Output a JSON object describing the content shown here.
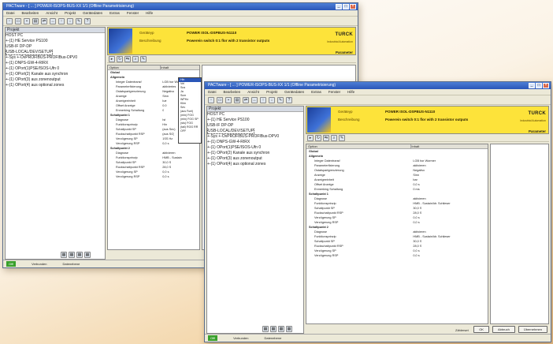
{
  "window1": {
    "title": "PACTware - [ ... ] POWER-ISOPS-BUS-XX 1/1 (Offline Parametrisierung)",
    "menu": [
      "Datei",
      "Bearbeiten",
      "Ansicht",
      "Projekt",
      "Gerätedaten",
      "Extras",
      "Fenster",
      "Hilfe"
    ],
    "tree_header": "Projekt",
    "tree": [
      "HOST PC",
      "+-(1) HE Service PS100",
      "   USB-IF DP-DP",
      "      USB-LOCAL/DEV/SETUP",
      "+-Sys  +-OvPROFIBUS-PROFIBus-DPV0",
      "      +-(1) DNPS-GW-4-RIRX",
      "         +-(1) OPort(1)PSE/ISOS-Ufn 0",
      "         +-(1) OPort(2) Kanale aus synchron",
      "         +-(1) OPort(3) aus zonenoutput",
      "         +-(1) OPort(4) aus optional zones"
    ],
    "banner": {
      "label1": "Geräteyp",
      "value1": "POWER ISOL-DSPBUS-N1110",
      "label2": "Beschreibung",
      "value2": "Powerein switch 0:1 flor with 2 transistor outputs",
      "logo": "TURCK",
      "logo_sub": "Industrial Automation",
      "param": "Parameter"
    },
    "grid_header": [
      "Option",
      "Inhalt"
    ],
    "rows": [
      {
        "k": "Global",
        "v": "",
        "sec": true
      },
      {
        "k": "Allgemein",
        "v": "",
        "sec": true
      },
      {
        "k": "Integer Datentransf",
        "v": "LGB hor Woo"
      },
      {
        "k": "Parameterfixierung",
        "v": "aktiviertes"
      },
      {
        "k": "Ostatspartgrenzierung",
        "v": "Negativo"
      },
      {
        "k": "Anzeige",
        "v": "Sinn"
      },
      {
        "k": "Anzeigeeinheit",
        "v": "Iue"
      },
      {
        "k": "Offset Anzeige",
        "v": "0.0"
      },
      {
        "k": "Enmerking Schaltung",
        "v": "0"
      },
      {
        "k": "Schaltpunkt 1",
        "v": "",
        "sec": true
      },
      {
        "k": "Diagnose",
        "v": "Ist"
      },
      {
        "k": "Funktionsprinzip",
        "v": "Hin"
      },
      {
        "k": "Schaltpunkt SP",
        "v": "(aus Sec)"
      },
      {
        "k": "Ruckschaltpunkt RSP",
        "v": "(aus SG)"
      },
      {
        "k": "Verzögerung SP",
        "v": "1SS Hz"
      },
      {
        "k": "Verzögerung RSP",
        "v": "0,0 s"
      },
      {
        "k": "Schaltpunkt 2",
        "v": "",
        "sec": true
      },
      {
        "k": "Diagnose",
        "v": "aktivieren"
      },
      {
        "k": "Funktionsprinzip",
        "v": "HMB - Sustain"
      },
      {
        "k": "Schaltpunkt SP",
        "v": "30,0 S"
      },
      {
        "k": "Ruckschaltpunkt RSP",
        "v": "28,0 S"
      },
      {
        "k": "Verzögerung SP",
        "v": "0,0 s"
      },
      {
        "k": "Verzögerung RSP",
        "v": "0,0 s"
      }
    ],
    "dropdown": [
      "Hin",
      "Vel",
      "Sus",
      "Ja",
      "Scm",
      "WPHz",
      "Klim",
      "Sev",
      "(aus Fuel)",
      "(min) FOG",
      "(min) FOG SP",
      "(stu) FOG",
      "(tail) ROG RR",
      "OFF"
    ],
    "dropdown_selected": "Hin",
    "footer_label": "Zählerset",
    "status": {
      "online": "Offl",
      "s1": "Verbunden",
      "s2": "Datenebene"
    }
  },
  "window2": {
    "title": "PACTware - [ ... ] POWER-ISOPS-BUS-XX 1/1 (Offline Parametrisierung)",
    "menu": [
      "Datei",
      "Bearbeiten",
      "Ansicht",
      "Projekt",
      "Gerätedaten",
      "Extras",
      "Fenster",
      "Hilfe"
    ],
    "tree_header": "Projekt",
    "tree": [
      "HOST PC",
      "+-(1) HE Service PS100",
      "   USB-IF DP-DP",
      "      USB-LOCAL/DEV/SETUP",
      "+-Sys  +-OvPROFIBUS-PROFIBus-DPV0",
      "      +-(1) DNPS-GW-4-RIRX",
      "         +-(1) OPort(1)PSE/ISOS-Ufn 0",
      "         +-(1) OPort(2) Kanale aus synchron",
      "         +-(1) OPort(3) aus zonenoutput",
      "         +-(1) OPort(4) aus optional zones"
    ],
    "banner": {
      "label1": "Geräteyp",
      "value1": "POWER ISOL-DSPBUS-N1110",
      "label2": "Beschreibung",
      "value2": "Powerein switch 0:1 flor with 2 transistor outputs",
      "logo": "TURCK",
      "logo_sub": "Industrial Automation",
      "param": "Parameter"
    },
    "grid_header": [
      "Option",
      "Inhalt"
    ],
    "rows": [
      {
        "k": "Global",
        "v": "",
        "sec": true
      },
      {
        "k": "Allgemein",
        "v": "",
        "sec": true
      },
      {
        "k": "Integer Datentransf",
        "v": "LGB hor Wormer"
      },
      {
        "k": "Parameterfixierung",
        "v": "aktivieren"
      },
      {
        "k": "Ostatspartgrenzierung",
        "v": "Negativo"
      },
      {
        "k": "Anzeige",
        "v": "Sinn"
      },
      {
        "k": "Anzeigeeinheit",
        "v": "bar"
      },
      {
        "k": "Offset Anzeige",
        "v": "0,0 s"
      },
      {
        "k": "Enmerking Schaltung",
        "v": "0 ms"
      },
      {
        "k": "Schaltpunkt 1",
        "v": "",
        "sec": true
      },
      {
        "k": "Diagnose",
        "v": "aktivieren"
      },
      {
        "k": "Funktionsprinzip",
        "v": "HMB - Sustain/ldr. Schlieser"
      },
      {
        "k": "Schaltpunkt SP",
        "v": "30,0 S"
      },
      {
        "k": "Ruckschaltpunkt RSP",
        "v": "28,0 S"
      },
      {
        "k": "Verzögerung SP",
        "v": "0,0 s"
      },
      {
        "k": "Verzögerung RSP",
        "v": "0,0 s"
      },
      {
        "k": "Schaltpunkt 2",
        "v": "",
        "sec": true
      },
      {
        "k": "Diagnose",
        "v": "aktivieren"
      },
      {
        "k": "Funktionsprinzip",
        "v": "HMB - Sustain/ldr. Schlieser"
      },
      {
        "k": "Schaltpunkt SP",
        "v": "30,0 S"
      },
      {
        "k": "Ruckschaltpunkt RSP",
        "v": "28,0 S"
      },
      {
        "k": "Verzögerung SP",
        "v": "0,0 s"
      },
      {
        "k": "Verzögerung RSP",
        "v": "0,0 s"
      }
    ],
    "buttons": [
      "OK",
      "Abbruch",
      "Übernehmen"
    ],
    "footer_label": "Zählerset",
    "status": {
      "online": "Offl",
      "s1": "Verbunden",
      "s2": "Datenebene"
    }
  },
  "colors": {
    "title": "#2a56b8",
    "banner": "#fde33a",
    "online": "#39a02c"
  }
}
